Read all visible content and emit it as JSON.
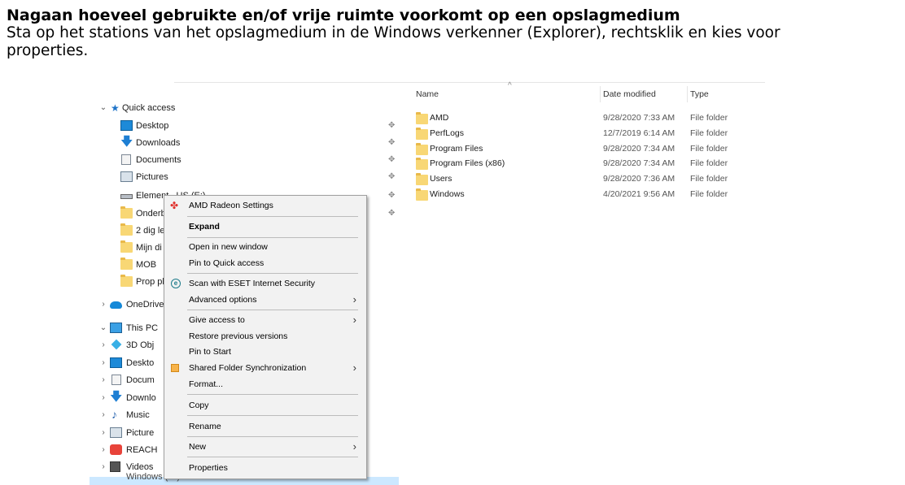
{
  "article": {
    "heading": "Nagaan hoeveel gebruikte en/of vrije ruimte voorkomt op een opslagmedium",
    "paragraph": "Sta op het stations van het opslagmedium in de Windows verkenner (Explorer), rechtsklik en kies voor properties."
  },
  "nav": {
    "quick_access": "Quick access",
    "quick_items": [
      "Desktop",
      "Downloads",
      "Documents",
      "Pictures",
      "Element...US (E:)",
      "Onderb",
      "2 dig le",
      "Mijn di",
      "MOB",
      "Prop pl"
    ],
    "onedrive": "OneDrive",
    "this_pc": "This PC",
    "pc_items": [
      "3D Obj",
      "Deskto",
      "Docum",
      "Downlo",
      "Music",
      "Picture",
      "REACH",
      "Videos",
      "Windows (C:)"
    ]
  },
  "files": {
    "columns": {
      "name": "Name",
      "date": "Date modified",
      "type": "Type"
    },
    "rows": [
      {
        "name": "AMD",
        "date": "9/28/2020 7:33 AM",
        "type": "File folder"
      },
      {
        "name": "PerfLogs",
        "date": "12/7/2019 6:14 AM",
        "type": "File folder"
      },
      {
        "name": "Program Files",
        "date": "9/28/2020 7:34 AM",
        "type": "File folder"
      },
      {
        "name": "Program Files (x86)",
        "date": "9/28/2020 7:34 AM",
        "type": "File folder"
      },
      {
        "name": "Users",
        "date": "9/28/2020 7:36 AM",
        "type": "File folder"
      },
      {
        "name": "Windows",
        "date": "4/20/2021 9:56 AM",
        "type": "File folder"
      }
    ]
  },
  "menu": {
    "amd": "AMD Radeon Settings",
    "expand": "Expand",
    "open_new": "Open in new window",
    "pin_quick": "Pin to Quick access",
    "eset": "Scan with ESET Internet Security",
    "advanced": "Advanced options",
    "give_access": "Give access to",
    "restore": "Restore previous versions",
    "pin_start": "Pin to Start",
    "shared_sync": "Shared Folder Synchronization",
    "format": "Format...",
    "copy": "Copy",
    "rename": "Rename",
    "new": "New",
    "properties": "Properties"
  },
  "colors": {
    "selection": "#cce8ff",
    "menu_bg": "#f2f2f2",
    "folder": "#f8d775",
    "amd_red": "#e0322d"
  }
}
